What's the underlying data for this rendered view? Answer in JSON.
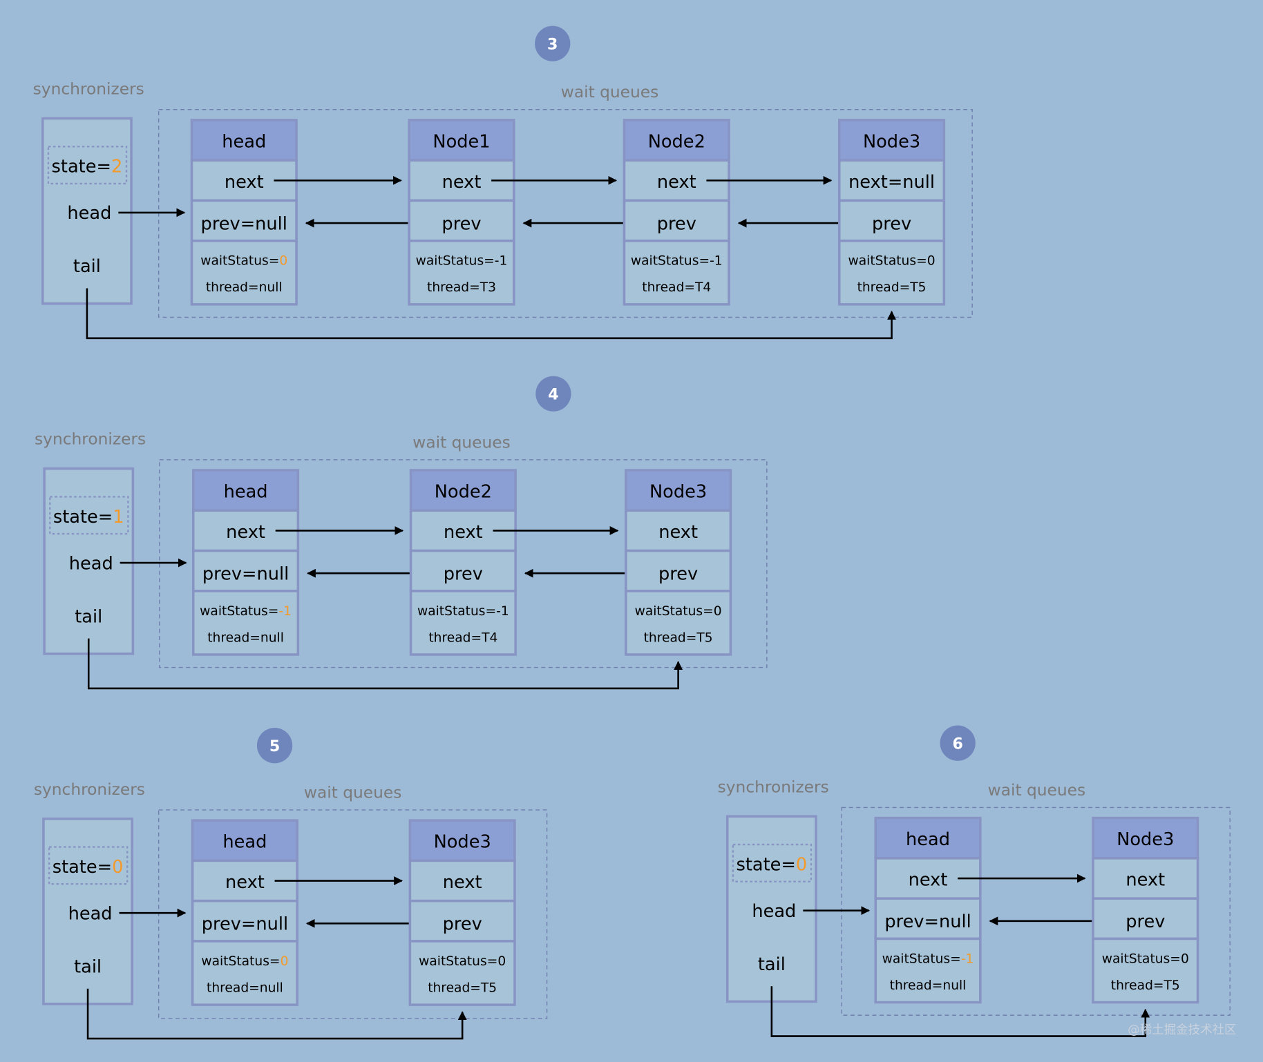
{
  "colors": {
    "background": "#9dbad7",
    "box_fill": "#a7c3d7",
    "box_border": "#8794c4",
    "header_fill": "#8c9fd4",
    "badge_fill": "#6f86bd",
    "highlight": "#f39a2b",
    "label_gray": "#7a7a7a",
    "arrow": "#000000"
  },
  "diagrams": [
    {
      "step": "3",
      "sync_label": "synchronizers",
      "queue_label": "wait queues",
      "sync": {
        "state_prefix": "state=",
        "state_value": "2",
        "head": "head",
        "tail": "tail"
      },
      "nodes": [
        {
          "title": "head",
          "next": "next",
          "prev": "prev=null",
          "ws_prefix": "waitStatus=",
          "ws_value": "0",
          "ws_highlight": true,
          "thread": "thread=null"
        },
        {
          "title": "Node1",
          "next": "next",
          "prev": "prev",
          "ws_prefix": "waitStatus=",
          "ws_value": "-1",
          "ws_highlight": false,
          "thread": "thread=T3"
        },
        {
          "title": "Node2",
          "next": "next",
          "prev": "prev",
          "ws_prefix": "waitStatus=",
          "ws_value": "-1",
          "ws_highlight": false,
          "thread": "thread=T4"
        },
        {
          "title": "Node3",
          "next": "next=null",
          "prev": "prev",
          "ws_prefix": "waitStatus=",
          "ws_value": "0",
          "ws_highlight": false,
          "thread": "thread=T5"
        }
      ]
    },
    {
      "step": "4",
      "sync_label": "synchronizers",
      "queue_label": "wait queues",
      "sync": {
        "state_prefix": "state=",
        "state_value": "1",
        "head": "head",
        "tail": "tail"
      },
      "nodes": [
        {
          "title": "head",
          "next": "next",
          "prev": "prev=null",
          "ws_prefix": "waitStatus=",
          "ws_value": "-1",
          "ws_highlight": true,
          "thread": "thread=null"
        },
        {
          "title": "Node2",
          "next": "next",
          "prev": "prev",
          "ws_prefix": "waitStatus=",
          "ws_value": "-1",
          "ws_highlight": false,
          "thread": "thread=T4"
        },
        {
          "title": "Node3",
          "next": "next",
          "prev": "prev",
          "ws_prefix": "waitStatus=",
          "ws_value": "0",
          "ws_highlight": false,
          "thread": "thread=T5"
        }
      ]
    },
    {
      "step": "5",
      "sync_label": "synchronizers",
      "queue_label": "wait queues",
      "sync": {
        "state_prefix": "state=",
        "state_value": "0",
        "head": "head",
        "tail": "tail"
      },
      "nodes": [
        {
          "title": "head",
          "next": "next",
          "prev": "prev=null",
          "ws_prefix": "waitStatus=",
          "ws_value": "0",
          "ws_highlight": true,
          "thread": "thread=null"
        },
        {
          "title": "Node3",
          "next": "next",
          "prev": "prev",
          "ws_prefix": "waitStatus=",
          "ws_value": "0",
          "ws_highlight": false,
          "thread": "thread=T5"
        }
      ]
    },
    {
      "step": "6",
      "sync_label": "synchronizers",
      "queue_label": "wait queues",
      "sync": {
        "state_prefix": "state=",
        "state_value": "0",
        "head": "head",
        "tail": "tail"
      },
      "nodes": [
        {
          "title": "head",
          "next": "next",
          "prev": "prev=null",
          "ws_prefix": "waitStatus=",
          "ws_value": "-1",
          "ws_highlight": true,
          "thread": "thread=null"
        },
        {
          "title": "Node3",
          "next": "next",
          "prev": "prev",
          "ws_prefix": "waitStatus=",
          "ws_value": "0",
          "ws_highlight": false,
          "thread": "thread=T5"
        }
      ]
    }
  ],
  "watermark": "@稀土掘金技术社区"
}
